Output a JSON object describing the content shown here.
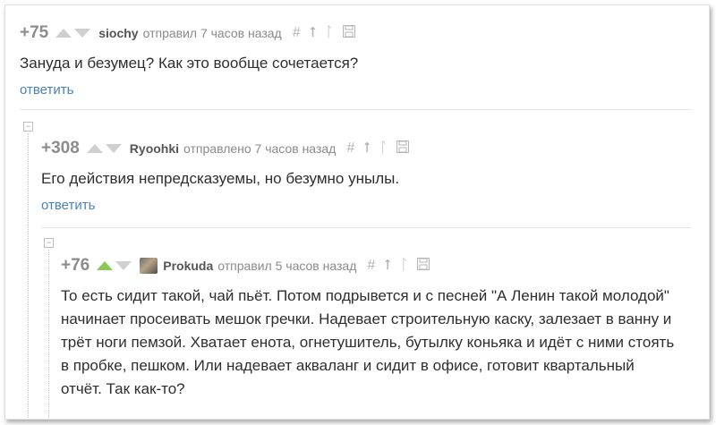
{
  "comments": [
    {
      "rating": "+75",
      "author": "siochy",
      "action": "отправил 7 часов назад",
      "text": "Зануда и безумец? Как это вообще сочетается?",
      "reply": "ответить"
    },
    {
      "rating": "+308",
      "author": "Ryoohki",
      "action": "отправлено 7 часов назад",
      "text": "Его действия непредсказуемы, но безумно унылы.",
      "reply": "ответить"
    },
    {
      "rating": "+76",
      "author": "Prokuda",
      "action": "отправил 5 часов назад",
      "text": "То есть сидит такой, чай пьёт. Потом подрывется и с песней \"А Ленин такой молодой\" начинает просеивать мешок гречки. Надевает строительную каску, залезает в ванну и трёт ноги пемзой. Хватает енота, огнетушитель, бутылку коньяка и идёт с ними стоять в пробке, пешком. Или надевает акваланг и сидит в офисе, готовит квартальный отчёт. Так как-то?"
    }
  ],
  "tools": {
    "hash": "#",
    "up": "⭡",
    "branch": "ᛚ",
    "save": "💾"
  },
  "collapse_symbol": "−",
  "colors": {
    "upvote_active": "#8ac858",
    "link": "#4a82b8"
  }
}
